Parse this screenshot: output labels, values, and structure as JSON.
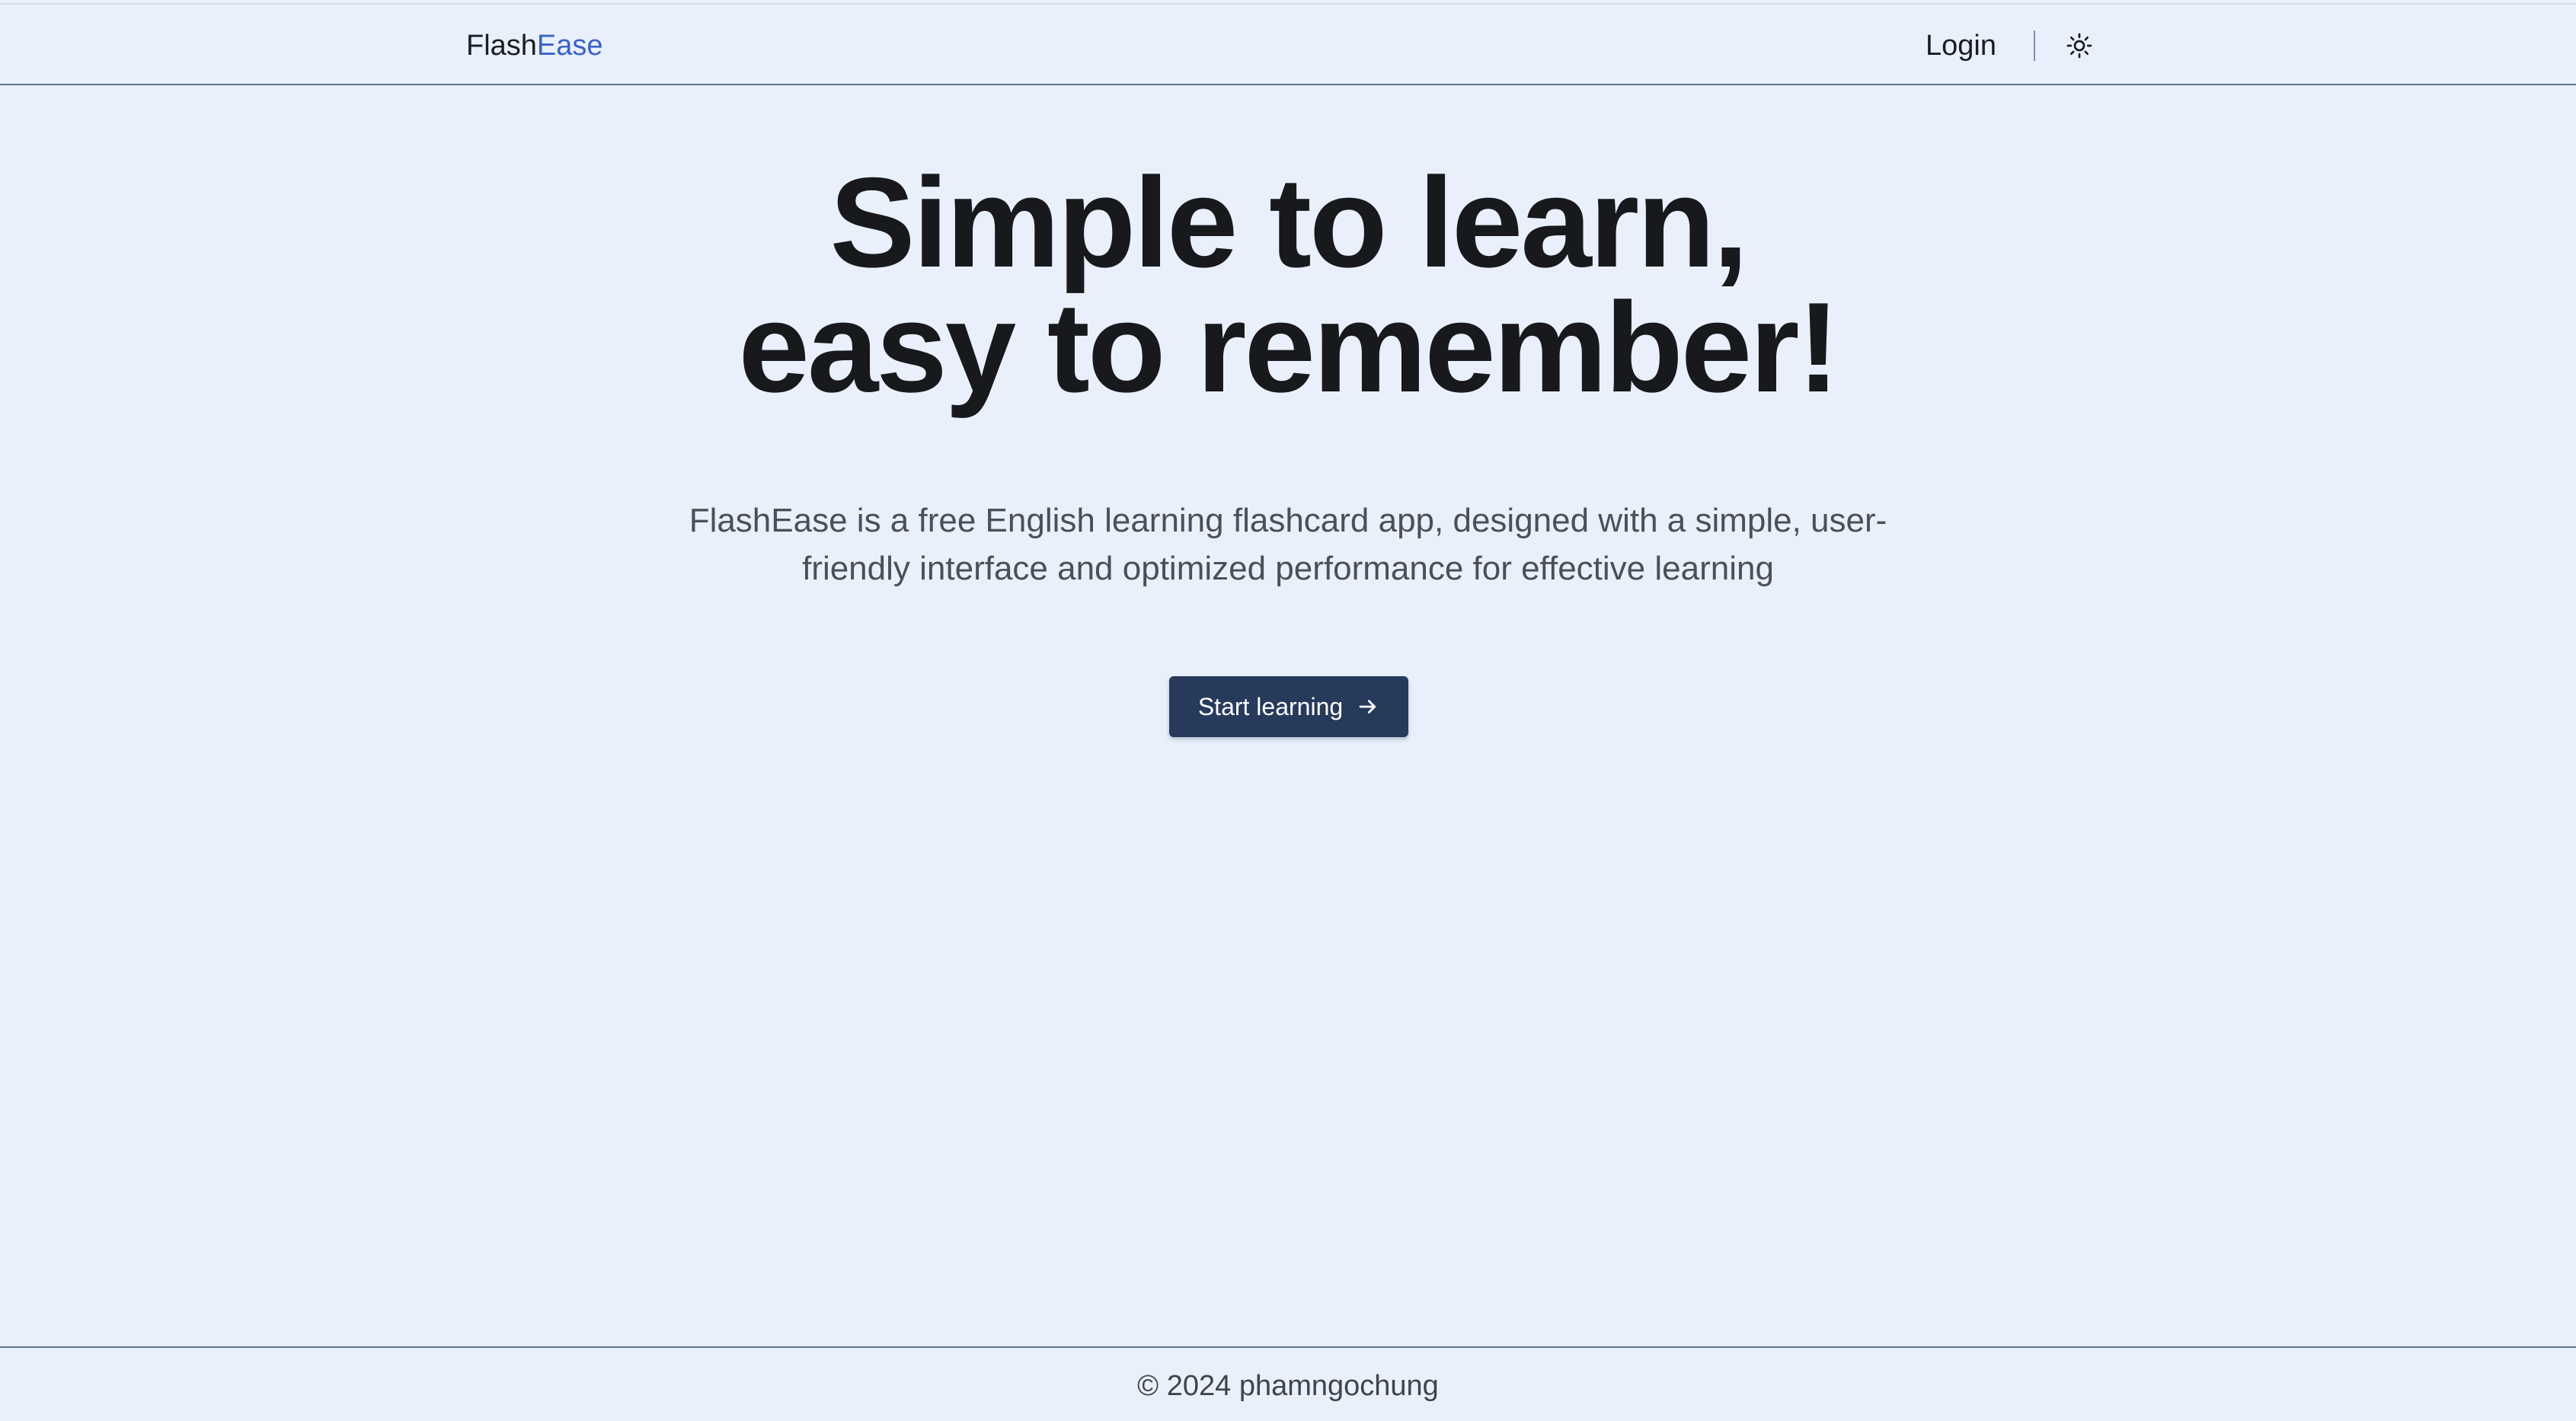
{
  "header": {
    "logo_part1": "Flash",
    "logo_part2": "Ease",
    "login_label": "Login",
    "theme_toggle_icon": "sun-icon"
  },
  "hero": {
    "title_line1": "Simple to learn,",
    "title_line2": "easy to remember!",
    "description": "FlashEase is a free English learning flashcard app, designed with a simple, user-friendly interface and optimized performance for effective learning",
    "cta_label": "Start learning",
    "cta_icon": "arrow-right-icon"
  },
  "footer": {
    "copyright": "© 2024 phamngochung"
  },
  "colors": {
    "background": "#e9f0fc",
    "accent": "#3a63c7",
    "button": "#273a5b",
    "text": "#17191d"
  }
}
